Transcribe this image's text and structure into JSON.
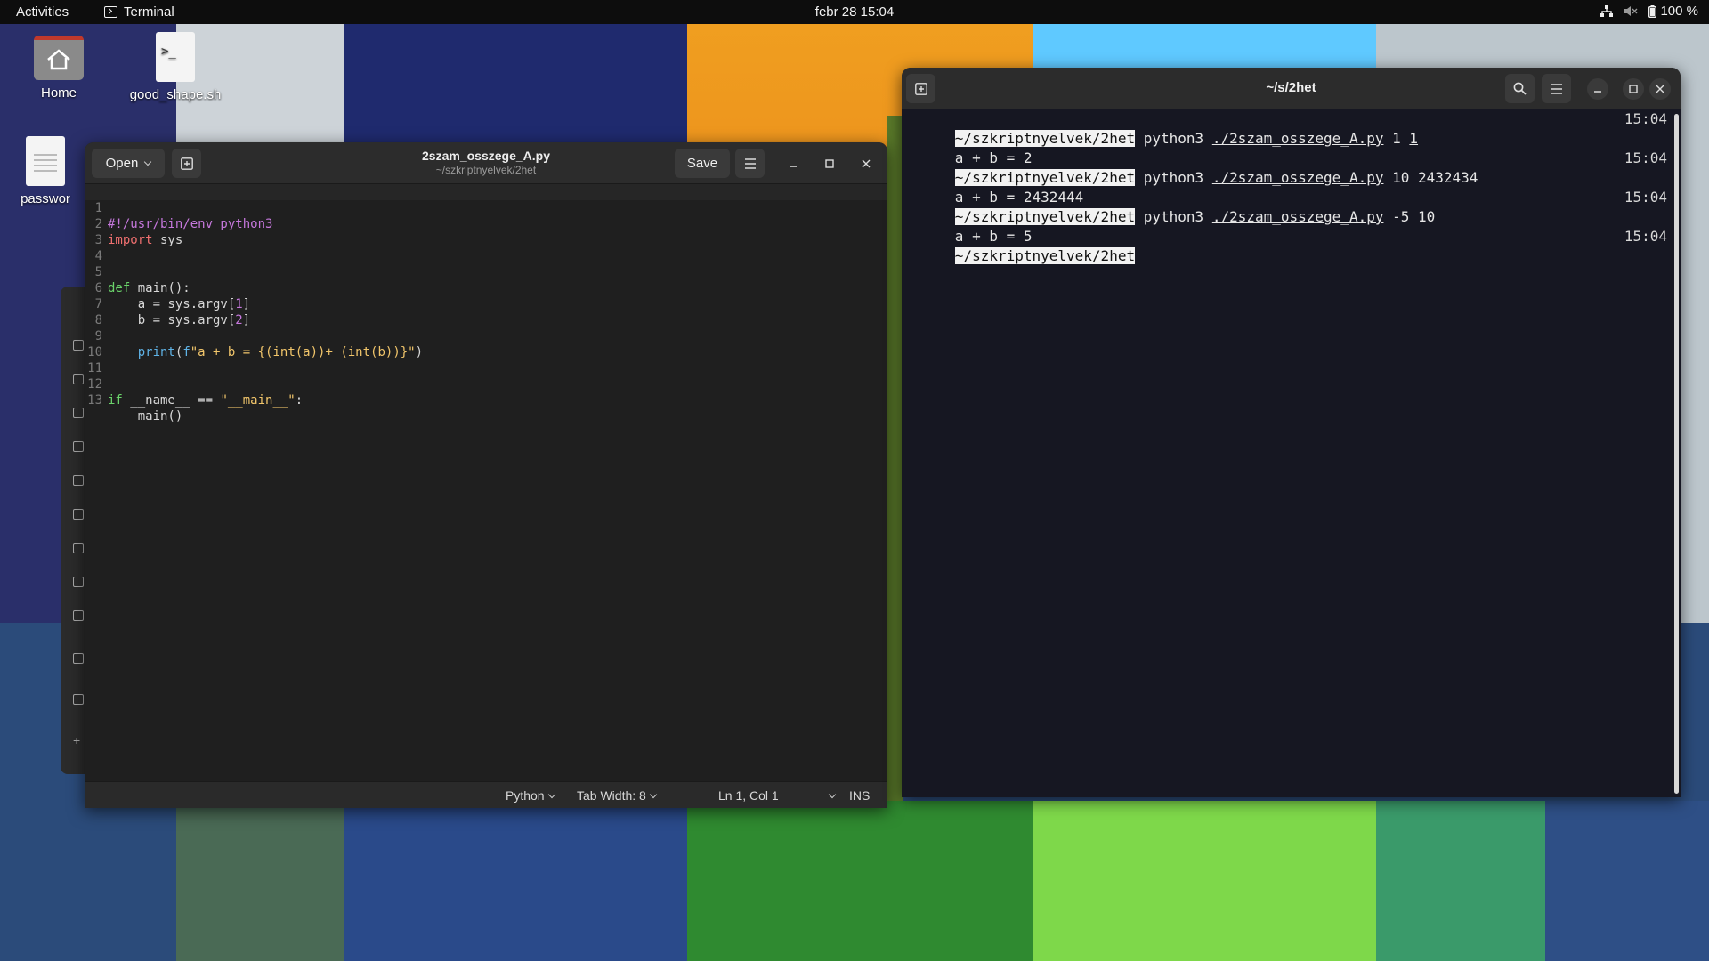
{
  "topbar": {
    "activities": "Activities",
    "app_name": "Terminal",
    "clock": "febr 28  15:04",
    "battery": "100 %"
  },
  "desktop": {
    "icons": [
      {
        "label": "Home",
        "icon": "home-folder-icon"
      },
      {
        "label": "good_shape.sh",
        "icon": "script-file-icon"
      },
      {
        "label": "passwor",
        "icon": "text-file-icon"
      }
    ]
  },
  "gedit": {
    "open_label": "Open",
    "save_label": "Save",
    "title": "2szam_osszege_A.py",
    "subtitle": "~/szkriptnyelvek/2het",
    "lines": [
      {
        "n": "1",
        "text": "#!/usr/bin/env python3"
      },
      {
        "n": "2",
        "text": "import sys"
      },
      {
        "n": "3",
        "text": ""
      },
      {
        "n": "4",
        "text": ""
      },
      {
        "n": "5",
        "text": "def main():"
      },
      {
        "n": "6",
        "text": "    a = sys.argv[1]"
      },
      {
        "n": "7",
        "text": "    b = sys.argv[2]"
      },
      {
        "n": "8",
        "text": ""
      },
      {
        "n": "9",
        "text": "    print(f\"a + b = {(int(a))+ (int(b))}\")"
      },
      {
        "n": "10",
        "text": ""
      },
      {
        "n": "11",
        "text": ""
      },
      {
        "n": "12",
        "text": "if __name__ == \"__main__\":"
      },
      {
        "n": "13",
        "text": "    main()"
      }
    ],
    "status": {
      "language": "Python",
      "tab_width": "Tab Width: 8",
      "position": "Ln 1, Col 1",
      "mode": "INS"
    }
  },
  "terminal": {
    "title": "~/s/2het",
    "lines": [
      {
        "prompt": "~/szkriptnyelvek/2het",
        "cmd": "python3",
        "script": "./2szam_osszege_A.py",
        "args": "1",
        "arg_link": "1",
        "time": "15:04"
      },
      {
        "output": "a + b = 2"
      },
      {
        "prompt": "~/szkriptnyelvek/2het",
        "cmd": "python3",
        "script": "./2szam_osszege_A.py",
        "args": "10 2432434",
        "time": "15:04"
      },
      {
        "output": "a + b = 2432444"
      },
      {
        "prompt": "~/szkriptnyelvek/2het",
        "cmd": "python3",
        "script": "./2szam_osszege_A.py",
        "args": "-5 10",
        "time": "15:04"
      },
      {
        "output": "a + b = 5"
      },
      {
        "prompt": "~/szkriptnyelvek/2het",
        "time": "15:04"
      }
    ]
  }
}
